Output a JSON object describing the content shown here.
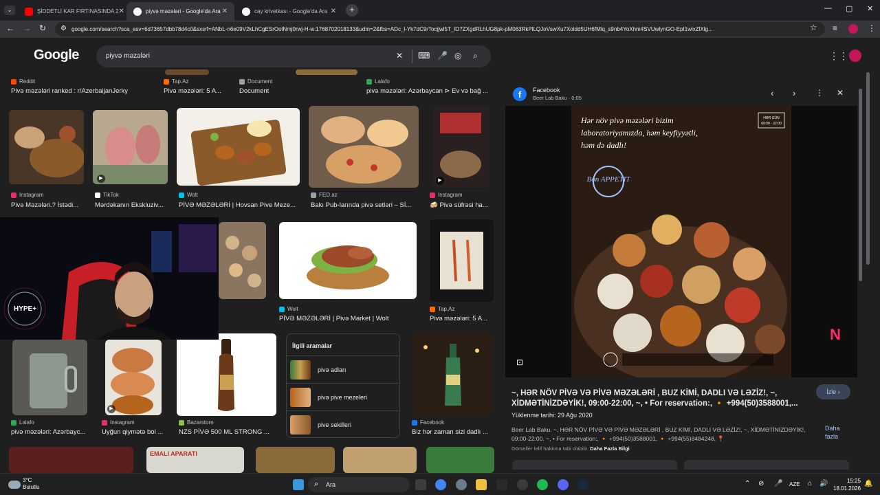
{
  "tabs": [
    {
      "label": "ŞİDDETLİ KAR FIRTINASINDA 2",
      "close": "✕",
      "icon_color": "#ff0000"
    },
    {
      "label": "piyvə məzələri - Google'da Ara",
      "close": "✕",
      "icon_color": "#4285f4"
    },
    {
      "label": "cay krivetkası - Google'da Ara",
      "close": "✕",
      "icon_color": "#4285f4"
    }
  ],
  "new_tab": "+",
  "window_controls": {
    "minimize": "—",
    "maximize": "▢",
    "close": "✕"
  },
  "address_bar": {
    "url": "google.com/search?sca_esv=6d73657dbb78d4c0&sxsrf=ANbL-n6e09V2kLhCgESrOolNmj0rwj-H-w:1768702018133&udm=2&fbs=ADc_l-Yk7dC9rTocjjwl5T_lO7ZXgdRLhUG8pk-pM063RkPlLQJoVswXu7Xoldd5UH6fMlq_s9nb4YoXhm4SVUwlynGO-EpI1wixZlXlg..."
  },
  "search": {
    "logo": "Google",
    "query": "piyvə məzələri",
    "clear": "✕"
  },
  "top_captions": [
    {
      "source": "Reddit",
      "title": "Pivə məzələri ranked : r/AzerbaijanJerky",
      "color": "#ff4500"
    },
    {
      "source": "Tap.Az",
      "title": "Pivə məzələri: 5 A...",
      "color": "#ff6a00"
    },
    {
      "source": "Document",
      "title": "Document",
      "color": "#9aa0a6"
    },
    {
      "source": "Lalafo",
      "title": "pivə məzələri: Azərbaycan ⊳ Ev və bağ ...",
      "color": "#34a853"
    }
  ],
  "row2_captions": [
    {
      "source": "Instagram",
      "title": "Pivə Məzələri.? İstədi...",
      "color": "#e1306c"
    },
    {
      "source": "TikTok",
      "title": "Mərdəkanın Ekskluziv...",
      "color": "#ffffff"
    },
    {
      "source": "Wolt",
      "title": "PİVƏ MƏZƏLƏRİ | Hovsan Pive Meze...",
      "color": "#00c2e8"
    },
    {
      "source": "FED.az",
      "title": "Bakı Pub-larında pivə setləri – Sİ...",
      "color": "#9aa0a6"
    },
    {
      "source": "Instagram",
      "title": "🍻 Pivə süfrəsi ha...",
      "color": "#e1306c"
    }
  ],
  "row3_captions": [
    {
      "source": "Wolt",
      "title": "PİVƏ MƏZƏLƏRİ | Pivə Market | Wolt",
      "color": "#00c2e8"
    },
    {
      "source": "Tap.Az",
      "title": "Pivə məzələri: 5 A...",
      "color": "#ff6a00"
    }
  ],
  "row4_captions": [
    {
      "source": "Lalafo",
      "title": "pivə məzələri: Azərbayc...",
      "color": "#34a853"
    },
    {
      "source": "Instagram",
      "title": "Uyğun qiymətə bol ...",
      "color": "#e1306c"
    },
    {
      "source": "Bazarstore",
      "title": "NZS PİVƏ 500 ML STRONG ...",
      "color": "#8bc34a"
    },
    {
      "source": "Facebook",
      "title": "Biz hər zaman sizi dadlı ...",
      "color": "#1877f2"
    }
  ],
  "related": {
    "title": "İlgili aramalar",
    "items": [
      {
        "label": "pivə adları"
      },
      {
        "label": "pivə pive mezeleri"
      },
      {
        "label": "pive sekilleri"
      }
    ]
  },
  "webcam": {
    "badge": "HYPE+"
  },
  "panel": {
    "source": "Facebook",
    "subtitle": "Beer Lab Baku · 0:05",
    "image_text_1": "Hər növ pivə məzələri bizim",
    "image_text_2": "laboratoriyamızda, həm keyfiyyətli,",
    "image_text_3": "həm də dadlı!",
    "image_badge": "Bon APPETIT",
    "image_hours_1": "HƏR GÜN",
    "image_hours_2": "09:00 - 22:00",
    "title": "~, HƏR NÖV PİVƏ VƏ PİVƏ MƏZƏLƏRİ , BUZ KİMİ, DADLI VƏ LƏZİZ!, ~, XİDMƏTİNİZDƏYİK!, 09:00-22:00, ~, • For reservation:, 🔸 +994(50)3588001,...",
    "watch": "İzle",
    "upload_date": "Yüklenme tarihi: 29 Ağu 2020",
    "description": "Beer Lab Baku. ~, HƏR NÖV PİVƏ VƏ PİVƏ MƏZƏLƏRİ , BUZ KİMİ, DADLI VƏ LƏZİZ!, ~, XİDMƏTİNİZDƏYİK!, 09:00-22:00. ~, • For reservation:, 🔸 +994(50)3588001, 🔸 +994(55)8484248, 📍",
    "more": "Daha fazla",
    "copyright": "Görseller telif hakkına tabi olabilir.",
    "more_info": "Daha Fazla Bilgi"
  },
  "taskbar": {
    "weather_temp": "3°C",
    "weather_desc": "Bulutlu",
    "search": "Ara",
    "lang": "AZE",
    "time": "15:25",
    "date": "18.01.2026"
  }
}
